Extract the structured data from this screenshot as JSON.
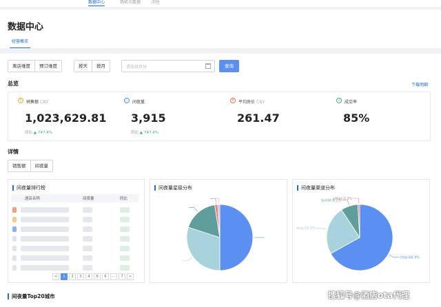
{
  "topnav": {
    "items": [
      "数据中心",
      "商机与数据",
      "问住"
    ]
  },
  "header": {
    "title": "数据中心",
    "sub_tab": "经营概览"
  },
  "filters": {
    "dimension": [
      "离店维度",
      "预订维度"
    ],
    "granularity": [
      "按天",
      "按月"
    ],
    "date_placeholder": "请选择月份",
    "query_label": "查询"
  },
  "overview": {
    "title": "总览",
    "download_label": "下载明细",
    "kpis": [
      {
        "label": "销售额",
        "unit": "CNY",
        "value": "1,023,629.81",
        "cmp_label": "同比",
        "cmp_value": "747.4%",
        "icon": "sales-icon",
        "color": "#f5a623"
      },
      {
        "label": "间夜量",
        "unit": "",
        "value": "3,915",
        "cmp_label": "同比",
        "cmp_value": "747.4%",
        "icon": "room-night-icon",
        "color": "#5b8ff0"
      },
      {
        "label": "平均房价",
        "unit": "CNY",
        "value": "261.47",
        "cmp_label": "",
        "cmp_value": "",
        "icon": "avg-price-icon",
        "color": "#f0723a"
      },
      {
        "label": "成交率",
        "unit": "",
        "value": "85%",
        "cmp_label": "",
        "cmp_value": "",
        "icon": "conversion-icon",
        "color": "#3ab07a"
      }
    ]
  },
  "detail": {
    "title": "详情",
    "tabs": [
      "销售额",
      "间夜量"
    ]
  },
  "ranking_panel": {
    "title": "间夜量排行榜",
    "columns": [
      "酒店名称",
      "间夜量",
      "同比"
    ],
    "pager": [
      "<",
      "1",
      "2",
      "3",
      "4",
      "5",
      "6",
      "···",
      "7",
      ">"
    ]
  },
  "star_panel": {
    "title": "间夜量星级分布"
  },
  "channel_panel": {
    "title": "间夜量渠道分布"
  },
  "bottom": {
    "title": "间夜量Top20城市"
  },
  "watermark": "搜狐号@酒店ota代理",
  "chart_data": [
    {
      "type": "pie",
      "title": "间夜量星级分布",
      "slices": [
        {
          "name": "",
          "value": 50.0,
          "color": "#5b8ff0"
        },
        {
          "name": "",
          "value": 30.0,
          "color": "#a9d3dc"
        },
        {
          "name": "",
          "value": 17.5,
          "color": "#5f9e9a"
        },
        {
          "name": "",
          "value": 1.5,
          "color": "#e8838a"
        },
        {
          "name": "",
          "value": 1.0,
          "color": "#c9b4d8"
        }
      ]
    },
    {
      "type": "pie",
      "title": "间夜量渠道分布",
      "slices": [
        {
          "name": "ctrip",
          "label": "ctrip:66.9%",
          "value": 66.9,
          "color": "#5b8ff0"
        },
        {
          "name": "wxg",
          "label": "wxg:23.9%",
          "value": 23.9,
          "color": "#a9d3dc"
        },
        {
          "name": "qunar",
          "label": "qunar:8.3%",
          "value": 8.3,
          "color": "#5f9e9a"
        },
        {
          "name": "other",
          "label": "other:0.9%",
          "value": 0.9,
          "color": "#e8838a"
        }
      ]
    }
  ]
}
